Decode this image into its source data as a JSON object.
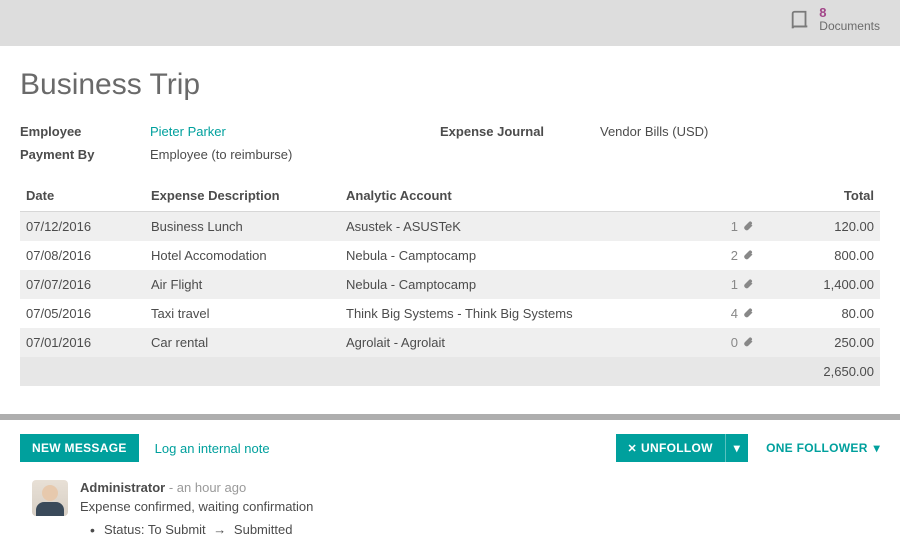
{
  "topbar": {
    "documents_count": "8",
    "documents_label": "Documents"
  },
  "title": "Business Trip",
  "fields": {
    "employee_label": "Employee",
    "employee_value": "Pieter Parker",
    "payment_by_label": "Payment By",
    "payment_by_value": "Employee (to reimburse)",
    "journal_label": "Expense Journal",
    "journal_value": "Vendor Bills (USD)"
  },
  "table": {
    "headers": {
      "date": "Date",
      "desc": "Expense Description",
      "acct": "Analytic Account",
      "total": "Total"
    },
    "rows": [
      {
        "date": "07/12/2016",
        "desc": "Business Lunch",
        "acct": "Asustek - ASUSTeK",
        "attach": "1",
        "total": "120.00"
      },
      {
        "date": "07/08/2016",
        "desc": "Hotel Accomodation",
        "acct": "Nebula - Camptocamp",
        "attach": "2",
        "total": "800.00"
      },
      {
        "date": "07/07/2016",
        "desc": "Air Flight",
        "acct": "Nebula - Camptocamp",
        "attach": "1",
        "total": "1,400.00"
      },
      {
        "date": "07/05/2016",
        "desc": "Taxi travel",
        "acct": "Think Big Systems - Think Big Systems",
        "attach": "4",
        "total": "80.00"
      },
      {
        "date": "07/01/2016",
        "desc": "Car rental",
        "acct": "Agrolait - Agrolait",
        "attach": "0",
        "total": "250.00"
      }
    ],
    "grand_total": "2,650.00"
  },
  "chatter": {
    "new_message": "NEW MESSAGE",
    "log_note": "Log an internal note",
    "unfollow": "UNFOLLOW",
    "followers": "ONE FOLLOWER",
    "msg": {
      "author": "Administrator",
      "time": "- an hour ago",
      "text": "Expense confirmed, waiting confirmation",
      "status_label": "Status:",
      "status_from": "To Submit",
      "status_to": "Submitted"
    }
  }
}
